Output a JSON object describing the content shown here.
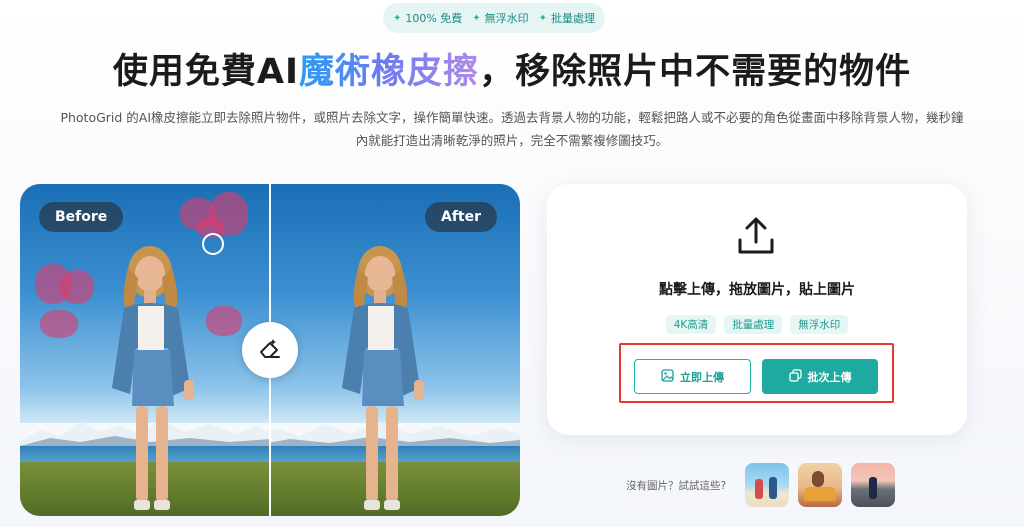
{
  "badges": [
    {
      "icon": "sparkle-icon",
      "label": "100% 免費"
    },
    {
      "icon": "sparkle-icon",
      "label": "無浮水印"
    },
    {
      "icon": "sparkle-icon",
      "label": "批量處理"
    }
  ],
  "headline": {
    "prefix": "使用免費AI",
    "highlight": "魔術橡皮擦",
    "suffix": "，移除照片中不需要的物件"
  },
  "subtitle": {
    "line1": "PhotoGrid 的AI橡皮擦能立即去除照片物件，或照片去除文字，操作簡單快速。透過去背景人物的功能，輕鬆把路人或不必要的角色從畫面中移除背景人物，幾秒鐘",
    "line2": "內就能打造出清晰乾淨的照片，完全不需繁複修圖技巧。"
  },
  "compare": {
    "before_label": "Before",
    "after_label": "After"
  },
  "upload": {
    "prompt": "點擊上傳，拖放圖片，貼上圖片",
    "features": [
      "4K高清",
      "批量處理",
      "無浮水印"
    ],
    "upload_now_label": "立即上傳",
    "batch_upload_label": "批次上傳"
  },
  "samples": {
    "label": "沒有圖片？試試這些?",
    "thumbnails": [
      "sample-beach-photo",
      "sample-car-photo",
      "sample-road-photo"
    ]
  },
  "colors": {
    "accent": "#1eaaa0",
    "highlight_box": "#e8392d",
    "erase_mask": "#dc3c6e"
  }
}
